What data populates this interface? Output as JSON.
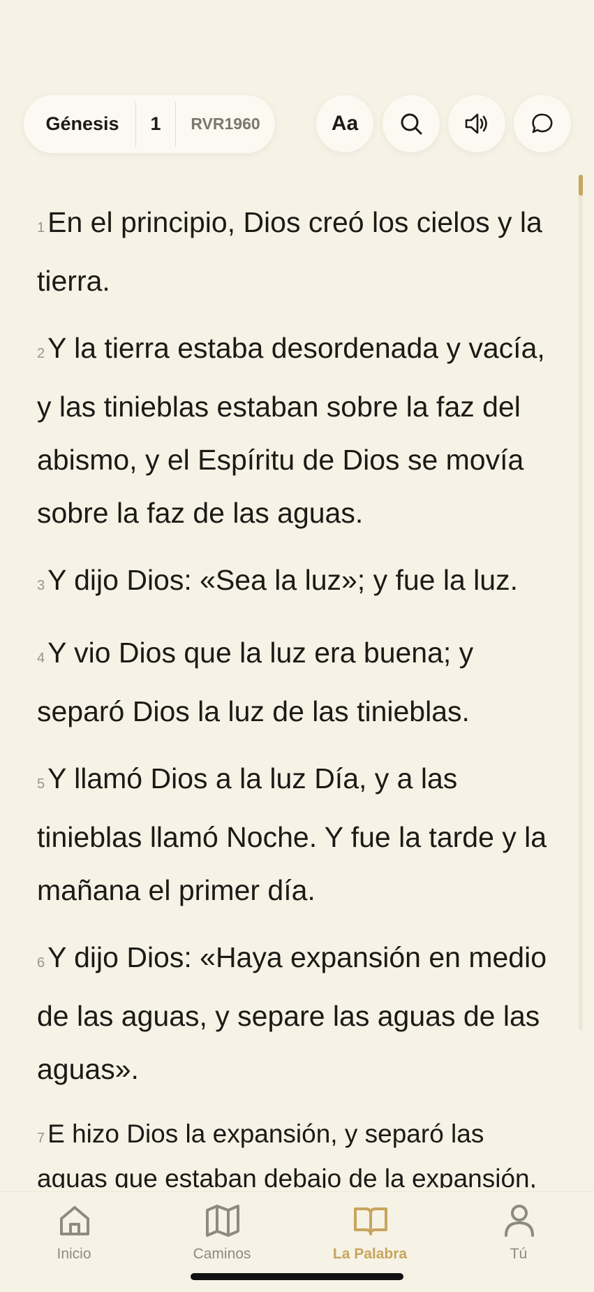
{
  "header": {
    "book": "Génesis",
    "chapter": "1",
    "version": "RVR1960",
    "font_button": "Aa",
    "icons": [
      "search-icon",
      "speaker-icon",
      "chat-bubble-icon"
    ]
  },
  "verses": [
    {
      "num": "1",
      "text": "En el principio, Dios creó los cielos y la tierra."
    },
    {
      "num": "2",
      "text": "Y la tierra estaba desordenada y vacía, y las tinieblas estaban sobre la faz del abismo, y el Espíritu de Dios se movía sobre la faz de las aguas."
    },
    {
      "num": "3",
      "text": "Y dijo Dios: «Sea la luz»; y fue la luz."
    },
    {
      "num": "4",
      "text": "Y vio Dios que la luz era buena; y separó Dios la luz de las tinieblas."
    },
    {
      "num": "5",
      "text": "Y llamó Dios a la luz Día, y a las tinieblas llamó Noche. Y fue la tarde y la mañana el primer día."
    },
    {
      "num": "6",
      "text": "Y dijo Dios: «Haya expansión en medio de las aguas, y separe las aguas de las aguas»."
    },
    {
      "num": "7",
      "text": "E hizo Dios la expansión, y separó las aguas que estaban debajo de la expansión, de las aguas que estaban sobre la expansión; y fue así."
    }
  ],
  "nav": {
    "items": [
      {
        "label": "Inicio",
        "icon": "home-icon"
      },
      {
        "label": "Caminos",
        "icon": "map-icon"
      },
      {
        "label": "La Palabra",
        "icon": "open-book-icon",
        "active": true
      },
      {
        "label": "Tú",
        "icon": "person-icon"
      }
    ]
  },
  "colors": {
    "background": "#f6f2e5",
    "accent": "#c8a55d",
    "text": "#1b1a16",
    "muted": "#8d8a80"
  }
}
